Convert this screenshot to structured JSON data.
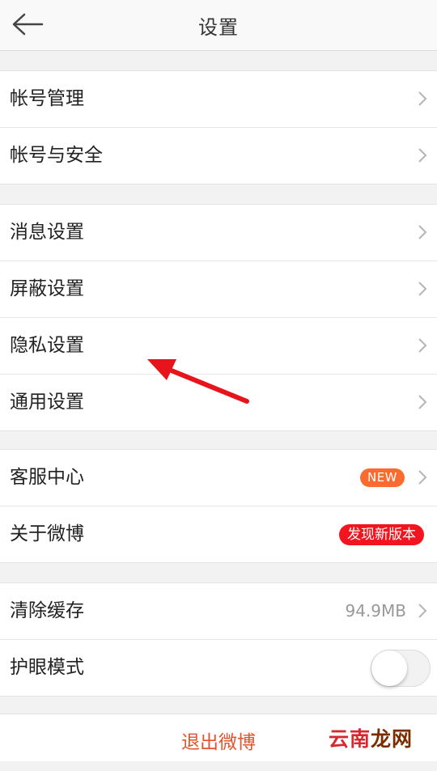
{
  "header": {
    "title": "设置",
    "back_icon": "arrow-left-icon"
  },
  "groups": [
    {
      "items": [
        {
          "label": "帐号管理"
        },
        {
          "label": "帐号与安全"
        }
      ]
    },
    {
      "items": [
        {
          "label": "消息设置"
        },
        {
          "label": "屏蔽设置"
        },
        {
          "label": "隐私设置"
        },
        {
          "label": "通用设置"
        }
      ]
    },
    {
      "items": [
        {
          "label": "客服中心",
          "badge": "NEW"
        },
        {
          "label": "关于微博",
          "badge": "发现新版本"
        }
      ]
    },
    {
      "items": [
        {
          "label": "清除缓存",
          "value": "94.9MB"
        },
        {
          "label": "护眼模式",
          "toggle_on": false
        }
      ]
    }
  ],
  "logout_label": "退出微博",
  "watermark": {
    "part1": "云南",
    "part2": "龙网"
  },
  "colors": {
    "accent_logout": "#e5522f",
    "badge_new": "#fb6b2f",
    "badge_update": "#f2151f",
    "annotation_arrow": "#e8141c"
  }
}
